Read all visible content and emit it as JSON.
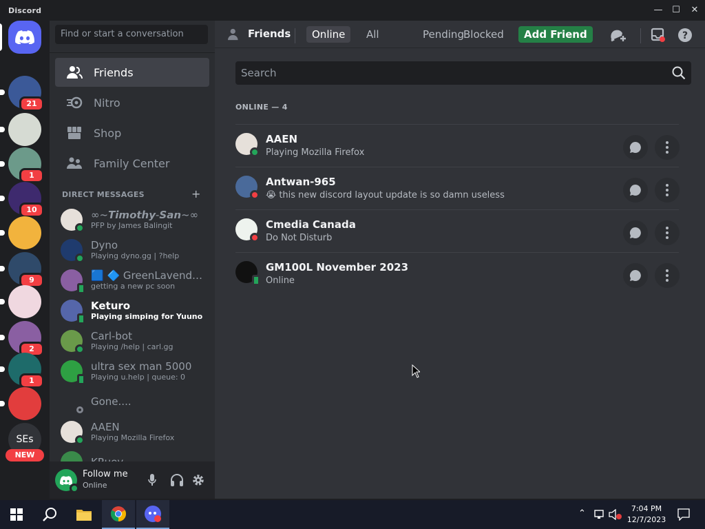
{
  "window": {
    "title": "Discord",
    "minimize": "—",
    "maximize": "☐",
    "close": "✕"
  },
  "servers": [
    {
      "badge": "21",
      "color": "#3b5998"
    },
    {
      "badge": "",
      "color": "#d6dbd3"
    },
    {
      "badge": "1",
      "color": "#6c9a8a"
    },
    {
      "badge": "10",
      "color": "#3e2a6e"
    },
    {
      "badge": "",
      "color": "#f2b33d"
    },
    {
      "badge": "9",
      "color": "#2f4a6a"
    },
    {
      "badge": "",
      "color": "#f0d8e0"
    },
    {
      "badge": "2",
      "color": "#8a5fa2"
    },
    {
      "badge": "1",
      "color": "#1e6b6a"
    },
    {
      "badge": "",
      "color": "#e23d3d"
    },
    {
      "label": "SEs",
      "badge": "NEW"
    }
  ],
  "sidebar": {
    "search_placeholder": "Find or start a conversation",
    "nav": [
      {
        "label": "Friends"
      },
      {
        "label": "Nitro"
      },
      {
        "label": "Shop"
      },
      {
        "label": "Family Center"
      }
    ],
    "dm_header": "DIRECT MESSAGES",
    "dm_add": "+",
    "dms": [
      {
        "name": "∞~𝙏𝙞𝙢𝙤𝙩𝙝𝙮-𝙎𝙖𝙣~∞",
        "status": "PFP by James Balingit",
        "state": "online",
        "color": "#e6e0da"
      },
      {
        "name": "Dyno",
        "status": "Playing dyno.gg | ?help",
        "state": "online",
        "color": "#1f3b6e"
      },
      {
        "name": "🟦 🔷 GreenLavender...",
        "status": "getting a new pc soon",
        "state": "mobile",
        "color": "#8a5fa2"
      },
      {
        "name": "Keturo",
        "status": "Playing simping for Yuuno",
        "state": "mobile",
        "color": "#5566aa",
        "bold": true
      },
      {
        "name": "Carl-bot",
        "status": "Playing /help | carl.gg",
        "state": "online",
        "color": "#6a9a4a"
      },
      {
        "name": "ultra sex man 5000",
        "status": "Playing u.help | queue: 0",
        "state": "mobile",
        "color": "#2ea043"
      },
      {
        "name": "Gone....",
        "status": "",
        "state": "offline",
        "color": "transparent"
      },
      {
        "name": "AAEN",
        "status": "Playing Mozilla Firefox",
        "state": "online",
        "color": "#e6e0da"
      },
      {
        "name": "KRuey",
        "status": "",
        "state": "online",
        "color": "#3a8a4a"
      }
    ],
    "user": {
      "name": "Follow me",
      "status": "Online"
    }
  },
  "header": {
    "title": "Friends",
    "tabs": [
      "Online",
      "All",
      "Pending",
      "Blocked"
    ],
    "add_friend": "Add Friend"
  },
  "friends": {
    "search_placeholder": "Search",
    "online_label": "ONLINE — 4",
    "list": [
      {
        "name": "AAEN",
        "status": "Playing Mozilla Firefox",
        "state": "online",
        "color": "#e6e0da"
      },
      {
        "name": "Antwan-965",
        "status": "😭 this new discord layout update is so damn useless",
        "state": "dnd",
        "color": "#4a6a9a"
      },
      {
        "name": "Cmedia Canada",
        "status": "Do Not Disturb",
        "state": "dnd",
        "color": "#eef3ee"
      },
      {
        "name": "GM100L November 2023",
        "status": "Online",
        "state": "mobile",
        "color": "#111111"
      }
    ]
  },
  "taskbar": {
    "time": "7:04 PM",
    "date": "12/7/2023"
  }
}
